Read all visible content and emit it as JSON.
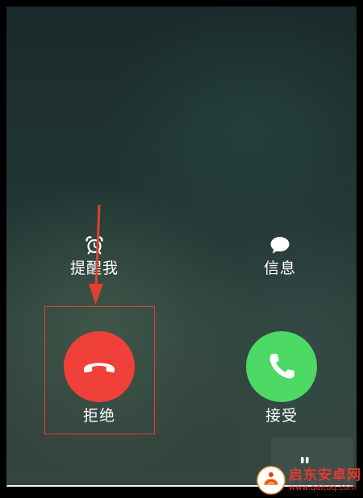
{
  "incoming_call": {
    "remind_me": {
      "label": "提醒我",
      "icon": "alarm-clock-icon"
    },
    "message": {
      "label": "信息",
      "icon": "chat-bubble-icon"
    },
    "decline": {
      "label": "拒绝",
      "icon": "hang-up-phone-icon",
      "color": "#f0403a"
    },
    "accept": {
      "label": "接受",
      "icon": "phone-icon",
      "color": "#4cd964"
    }
  },
  "annotation": {
    "highlight_color": "#e0402f",
    "arrow_color": "#e0402f"
  },
  "watermark": {
    "title": "启东安卓网",
    "url": "www.qdltdq.com"
  }
}
